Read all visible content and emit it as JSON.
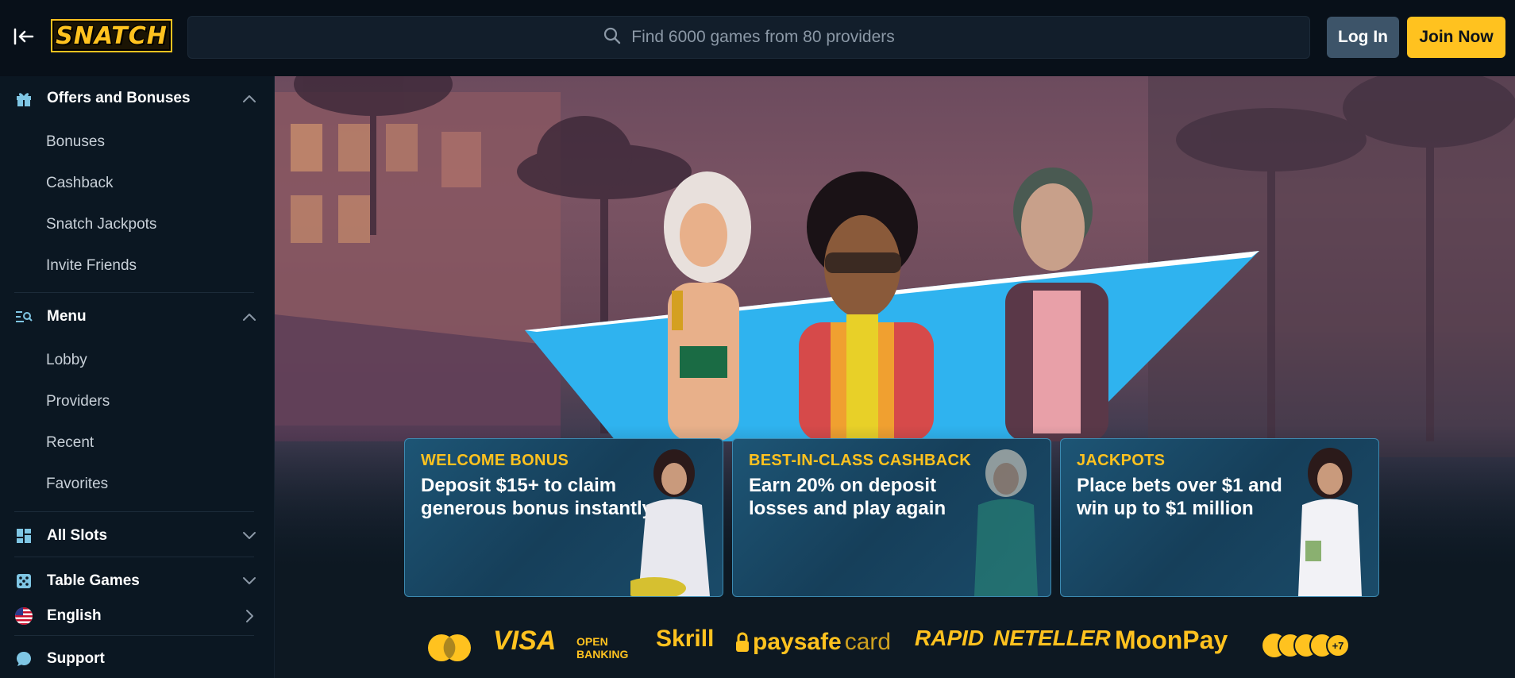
{
  "header": {
    "logo_text": "SNATCH",
    "search_placeholder": "Find 6000 games from 80 providers",
    "login_label": "Log In",
    "join_label": "Join Now"
  },
  "sidebar": {
    "offers": {
      "title": "Offers and Bonuses",
      "items": [
        "Bonuses",
        "Cashback",
        "Snatch Jackpots",
        "Invite Friends"
      ]
    },
    "menu": {
      "title": "Menu",
      "items": [
        "Lobby",
        "Providers",
        "Recent",
        "Favorites"
      ]
    },
    "all_slots": "All Slots",
    "table_games": "Table Games",
    "language": "English",
    "support": "Support"
  },
  "promos": [
    {
      "tag": "WELCOME BONUS",
      "desc": "Deposit $15+ to claim generous bonus instantly"
    },
    {
      "tag": "BEST-IN-CLASS CASHBACK",
      "desc": "Earn 20% on deposit losses and play again"
    },
    {
      "tag": "JACKPOTS",
      "desc": "Place bets over $1 and win up to $1 million"
    }
  ],
  "payments": {
    "visa": "VISA",
    "open_banking_1": "OPEN",
    "open_banking_2": "BANKING",
    "skrill": "Skrill",
    "paysafe_a": "paysafe",
    "paysafe_b": "card",
    "rapid": "RAPID",
    "neteller": "NETELLER",
    "moonpay": "MoonPay",
    "crypto_more": "+7"
  },
  "colors": {
    "accent": "#ffc21f",
    "login_bg": "#3d5469",
    "sidebar_bg": "#0b1722",
    "header_bg": "#081019",
    "promo_border": "#3d8bb2"
  }
}
